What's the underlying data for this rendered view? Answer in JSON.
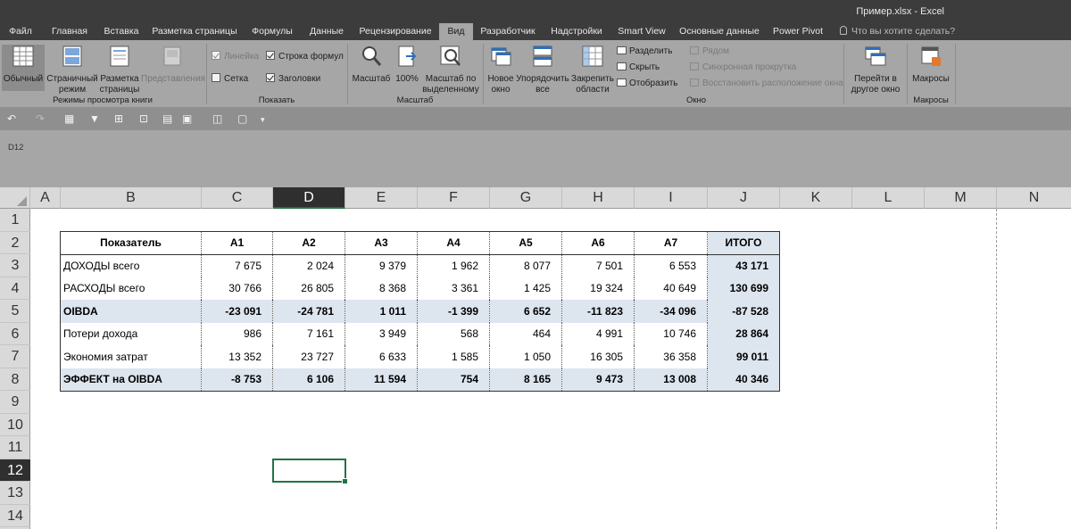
{
  "window": {
    "title": "Пример.xlsx - Excel"
  },
  "ribbon_tabs": [
    {
      "label": "Файл"
    },
    {
      "label": "Главная"
    },
    {
      "label": "Вставка"
    },
    {
      "label": "Разметка страницы"
    },
    {
      "label": "Формулы"
    },
    {
      "label": "Данные"
    },
    {
      "label": "Рецензирование"
    },
    {
      "label": "Вид"
    },
    {
      "label": "Разработчик"
    },
    {
      "label": "Надстройки"
    },
    {
      "label": "Smart View"
    },
    {
      "label": "Основные данные"
    },
    {
      "label": "Power Pivot"
    }
  ],
  "active_tab": "Вид",
  "tell_me": "Что вы хотите сделать?",
  "ribbon": {
    "views": {
      "normal": "Обычный",
      "pagebreak_1": "Страничный",
      "pagebreak_2": "режим",
      "pagelayout_1": "Разметка",
      "pagelayout_2": "страницы",
      "custom": "Представления",
      "group": "Режимы просмотра книги"
    },
    "show": {
      "ruler": "Линейка",
      "formula_bar": "Строка формул",
      "gridlines": "Сетка",
      "headings": "Заголовки",
      "group": "Показать"
    },
    "zoom": {
      "zoom": "Масштаб",
      "hundred": "100%",
      "to_sel_1": "Масштаб по",
      "to_sel_2": "выделенному",
      "group": "Масштаб"
    },
    "window": {
      "new_1": "Новое",
      "new_2": "окно",
      "arrange_1": "Упорядочить",
      "arrange_2": "все",
      "freeze_1": "Закрепить",
      "freeze_2": "области",
      "split": "Разделить",
      "hide": "Скрыть",
      "unhide": "Отобразить",
      "side": "Рядом",
      "sync": "Синхронная прокрутка",
      "reset": "Восстановить расположение окна",
      "switch_1": "Перейти в",
      "switch_2": "другое окно",
      "group": "Окно"
    },
    "macros": {
      "label": "Макросы",
      "group": "Макросы"
    }
  },
  "name_box": "D12",
  "columns": [
    "A",
    "B",
    "C",
    "D",
    "E",
    "F",
    "G",
    "H",
    "I",
    "J",
    "K",
    "L",
    "M",
    "N"
  ],
  "selected_column": "D",
  "rows": [
    "1",
    "2",
    "3",
    "4",
    "5",
    "6",
    "7",
    "8",
    "9",
    "10",
    "11",
    "12",
    "13",
    "14"
  ],
  "selected_row": "12",
  "table": {
    "headers": [
      "Показатель",
      "А1",
      "А2",
      "А3",
      "А4",
      "А5",
      "А6",
      "А7",
      "ИТОГО"
    ],
    "rows": [
      {
        "cells": [
          "ДОХОДЫ всего",
          "7 675",
          "2 024",
          "9 379",
          "1 962",
          "8 077",
          "7 501",
          "6 553",
          "43 171"
        ]
      },
      {
        "cells": [
          "РАСХОДЫ всего",
          "30 766",
          "26 805",
          "8 368",
          "3 361",
          "1 425",
          "19 324",
          "40 649",
          "130 699"
        ]
      },
      {
        "cells": [
          "OIBDA",
          "-23 091",
          "-24 781",
          "1 011",
          "-1 399",
          "6 652",
          "-11 823",
          "-34 096",
          "-87 528"
        ]
      },
      {
        "cells": [
          "Потери дохода",
          "986",
          "7 161",
          "3 949",
          "568",
          "464",
          "4 991",
          "10 746",
          "28 864"
        ]
      },
      {
        "cells": [
          "Экономия затрат",
          "13 352",
          "23 727",
          "6 633",
          "1 585",
          "1 050",
          "16 305",
          "36 358",
          "99 011"
        ]
      },
      {
        "cells": [
          "ЭФФЕКТ на OIBDA",
          "-8 753",
          "6 106",
          "11 594",
          "754",
          "8 165",
          "9 473",
          "13 008",
          "40 346"
        ]
      }
    ]
  },
  "colors": {
    "accent": "#217346",
    "shade": "#dde5ef",
    "ribbon": "#a6a6a6",
    "titlebar": "#3c3c3c"
  }
}
